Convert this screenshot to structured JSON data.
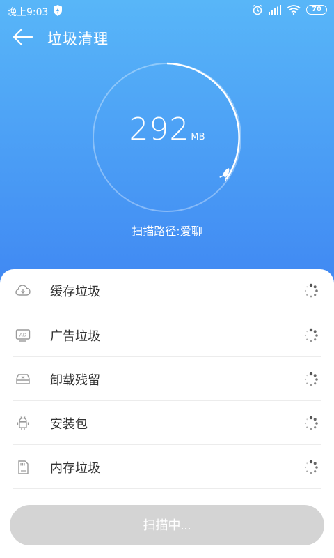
{
  "status": {
    "time": "晚上9:03",
    "battery": "70"
  },
  "header": {
    "title": "垃圾清理"
  },
  "scan": {
    "size_value": "292",
    "size_unit": "MB",
    "path_text": "扫描路径:爱聊"
  },
  "items": [
    {
      "label": "缓存垃圾",
      "icon": "cloud-download-icon"
    },
    {
      "label": "广告垃圾",
      "icon": "ad-icon"
    },
    {
      "label": "卸载残留",
      "icon": "uninstall-box-icon"
    },
    {
      "label": "安装包",
      "icon": "android-icon"
    },
    {
      "label": "内存垃圾",
      "icon": "sd-card-icon"
    }
  ],
  "button": {
    "label": "扫描中..."
  },
  "colors": {
    "header_top": "#58b6f8",
    "header_bottom": "#3f86f2",
    "button_disabled": "#d4d4d4"
  }
}
